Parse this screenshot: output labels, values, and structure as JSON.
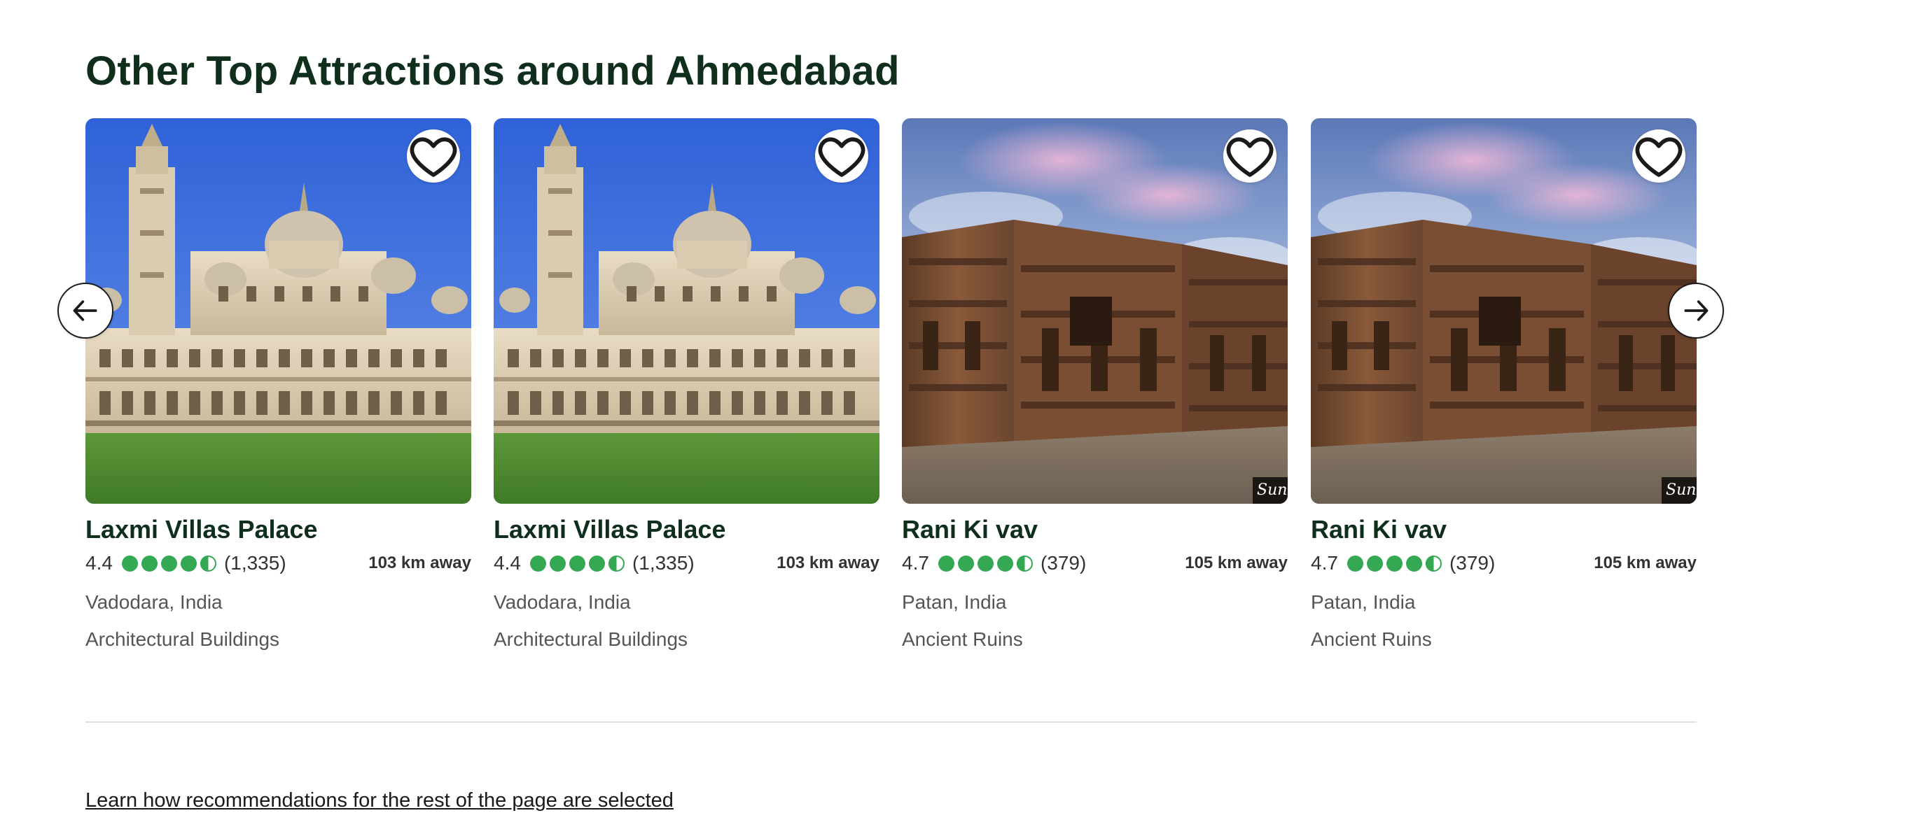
{
  "section": {
    "title": "Other Top Attractions around Ahmedabad"
  },
  "carousel": {
    "prev_icon": "arrow-left-icon",
    "next_icon": "arrow-right-icon",
    "cards": [
      {
        "name": "Laxmi Villas Palace",
        "rating": "4.4",
        "rating_value": 4.5,
        "reviews": "(1,335)",
        "distance": "103 km away",
        "location": "Vadodara, India",
        "category": "Architectural Buildings",
        "image": "palace-photo",
        "save_icon": "heart-icon"
      },
      {
        "name": "Laxmi Villas Palace",
        "rating": "4.4",
        "rating_value": 4.5,
        "reviews": "(1,335)",
        "distance": "103 km away",
        "location": "Vadodara, India",
        "category": "Architectural Buildings",
        "image": "palace-photo",
        "save_icon": "heart-icon"
      },
      {
        "name": "Rani Ki vav",
        "rating": "4.7",
        "rating_value": 4.5,
        "reviews": "(379)",
        "distance": "105 km away",
        "location": "Patan, India",
        "category": "Ancient Ruins",
        "image": "stepwell-photo",
        "watermark": "Sun",
        "save_icon": "heart-icon"
      },
      {
        "name": "Rani Ki vav",
        "rating": "4.7",
        "rating_value": 4.5,
        "reviews": "(379)",
        "distance": "105 km away",
        "location": "Patan, India",
        "category": "Ancient Ruins",
        "image": "stepwell-photo",
        "watermark": "Sun",
        "save_icon": "heart-icon"
      }
    ]
  },
  "footer": {
    "learn_link": "Learn how recommendations for the rest of the page are selected"
  },
  "colors": {
    "title": "#0f2f1c",
    "bubble": "#34a853",
    "bubble_dark": "#2b8a3e",
    "text_secondary": "#555555",
    "divider": "#e0e0e0"
  }
}
